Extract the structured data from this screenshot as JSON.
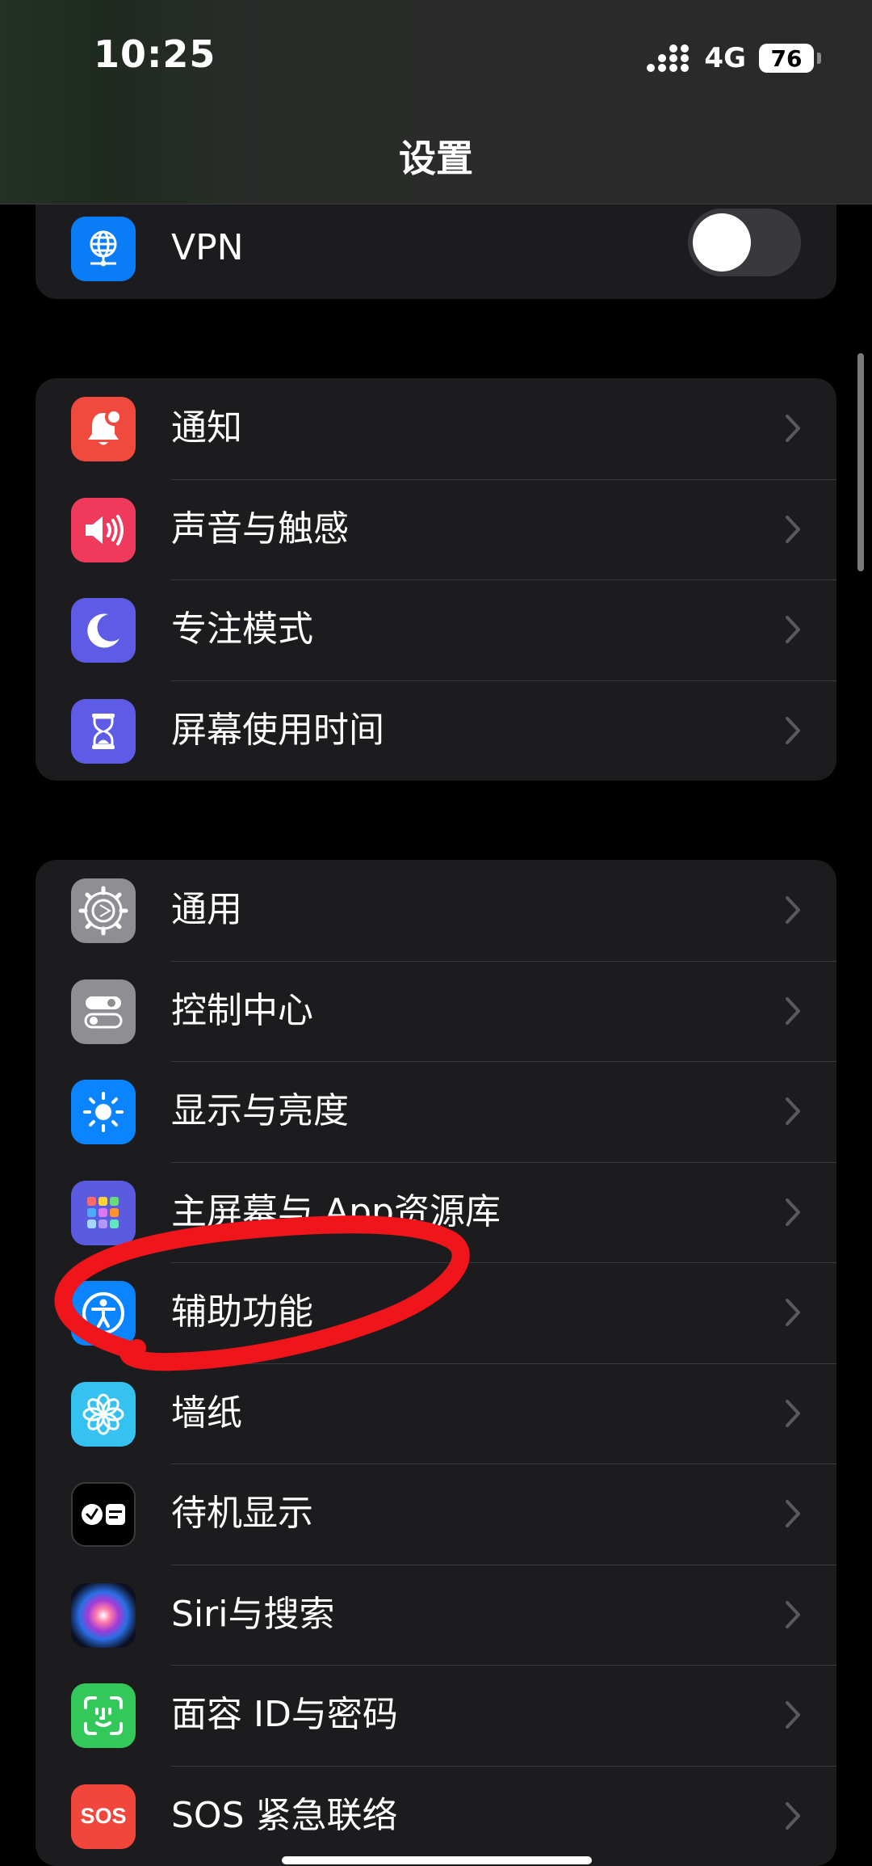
{
  "status_bar": {
    "time": "10:25",
    "network": "4G",
    "battery": "76"
  },
  "title": "设置",
  "groups": [
    {
      "items": [
        {
          "label": "VPN",
          "icon": "globe-network-icon",
          "color": "#0a7cf5",
          "control": "toggle",
          "toggle_on": false
        }
      ]
    },
    {
      "items": [
        {
          "label": "通知",
          "icon": "bell-badge-icon",
          "color": "#f04a3e"
        },
        {
          "label": "声音与触感",
          "icon": "speaker-icon",
          "color": "#f03a5c"
        },
        {
          "label": "专注模式",
          "icon": "moon-icon",
          "color": "#5e5ce6"
        },
        {
          "label": "屏幕使用时间",
          "icon": "hourglass-icon",
          "color": "#5e5ce6"
        }
      ]
    },
    {
      "items": [
        {
          "label": "通用",
          "icon": "gear-icon",
          "color": "#8e8e93"
        },
        {
          "label": "控制中心",
          "icon": "switches-icon",
          "color": "#8e8e93"
        },
        {
          "label": "显示与亮度",
          "icon": "sun-icon",
          "color": "#0a84ff"
        },
        {
          "label": "主屏幕与 App资源库",
          "icon": "app-grid-icon",
          "color": "#5b5be0"
        },
        {
          "label": "辅助功能",
          "icon": "accessibility-icon",
          "color": "#0a84ff"
        },
        {
          "label": "墙纸",
          "icon": "flower-icon",
          "color": "#35c2f0"
        },
        {
          "label": "待机显示",
          "icon": "standby-icon",
          "color": "#000000"
        },
        {
          "label": "Siri与搜索",
          "icon": "siri-icon",
          "color": "#1a1a2e"
        },
        {
          "label": "面容 ID与密码",
          "icon": "face-id-icon",
          "color": "#34c759"
        },
        {
          "label": "SOS 紧急联络",
          "icon": "sos-icon",
          "color": "#f0463c"
        }
      ]
    }
  ]
}
